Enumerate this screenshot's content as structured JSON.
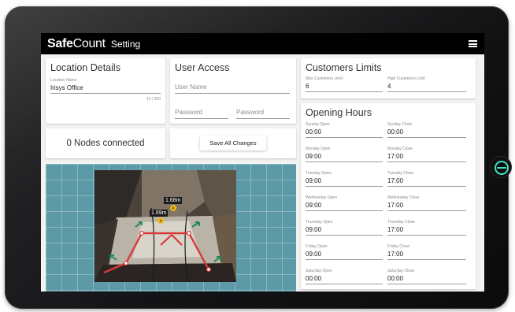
{
  "app": {
    "brand_bold": "Safe",
    "brand_rest": "Count",
    "title": "Setting"
  },
  "location": {
    "title": "Location Details",
    "name_label": "Location Name",
    "name_value": "Irisys Office",
    "char_count": "13 / 200"
  },
  "access": {
    "title": "User Access",
    "username_placeholder": "User Name",
    "password_placeholder": "Password",
    "password_confirm_placeholder": "Password"
  },
  "nodes": {
    "text": "0 Nodes connected"
  },
  "actions": {
    "save_label": "Save All Changes"
  },
  "limits": {
    "title": "Customers Limits",
    "max_label": "Max Customers Limit",
    "max_value": "6",
    "high_label": "High Customers Limit",
    "high_value": "4"
  },
  "hours": {
    "title": "Opening Hours",
    "days": [
      {
        "open_label": "Sunday Open",
        "open": "00:00",
        "close_label": "Sunday Close",
        "close": "00:00"
      },
      {
        "open_label": "Monday Open",
        "open": "09:00",
        "close_label": "Monday Close",
        "close": "17:00"
      },
      {
        "open_label": "Tuesday Open",
        "open": "09:00",
        "close_label": "Tuesday Close",
        "close": "17:00"
      },
      {
        "open_label": "Wednesday Open",
        "open": "09:00",
        "close_label": "Wednesday Close",
        "close": "17:00"
      },
      {
        "open_label": "Thursday Open",
        "open": "09:00",
        "close_label": "Thursday Close",
        "close": "17:00"
      },
      {
        "open_label": "Friday Open",
        "open": "09:00",
        "close_label": "Friday Close",
        "close": "17:00"
      },
      {
        "open_label": "Saturday Open",
        "open": "00:00",
        "close_label": "Saturday Close",
        "close": "00:00"
      }
    ]
  },
  "sensor_view": {
    "height_labels": [
      "1.68m",
      "1.69m"
    ]
  },
  "icons": {
    "menu": "hamburger-menu-icon",
    "home": "power-ring-icon"
  },
  "colors": {
    "appbar": "#000000",
    "grid_background": "#5d9aa8",
    "zone_line": "#d83a3a",
    "direction_arrow": "#1e8a5a",
    "home_ring": "#3fe0c4"
  }
}
